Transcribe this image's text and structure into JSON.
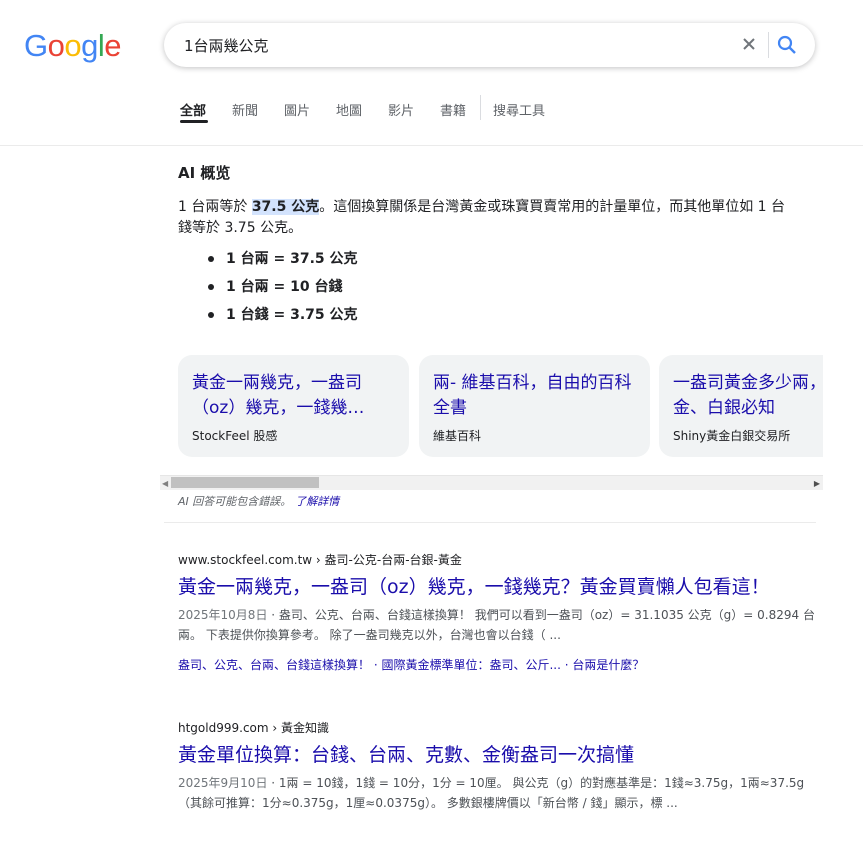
{
  "logo": {
    "letters": [
      "G",
      "o",
      "o",
      "g",
      "l",
      "e"
    ],
    "colors": [
      "#4285F4",
      "#EA4335",
      "#FBBC05",
      "#4285F4",
      "#34A853",
      "#EA4335"
    ]
  },
  "search": {
    "value": "1台兩幾公克"
  },
  "tabs": [
    "全部",
    "新聞",
    "圖片",
    "地圖",
    "影片",
    "書籍",
    "搜尋工具"
  ],
  "ai": {
    "title": "AI 概览",
    "para_pre": "1 台兩等於 ",
    "para_highlight": "37.5 公克",
    "para_post": "。這個換算關係是台灣黃金或珠寶買賣常用的計量單位，而其他單位如 1 台錢等於 3.75 公克。",
    "bullets": [
      "1 台兩 = 37.5 公克",
      "1 台兩 = 10 台錢",
      "1 台錢 = 3.75 公克"
    ],
    "cards": [
      {
        "title": "黃金一兩幾克，一盎司（oz）幾克，一錢幾…",
        "source": "StockFeel 股感"
      },
      {
        "title": "兩- 維基百科，自由的百科全書",
        "source": "維基百科"
      },
      {
        "title": "一盎司黃金多少兩，買黃金、白銀必知",
        "source": "Shiny黃金白銀交易所"
      }
    ],
    "disclaimer": "AI 回答可能包含錯誤。",
    "learn_more": "了解詳情"
  },
  "results": [
    {
      "url": "www.stockfeel.com.tw › 盎司-公克-台兩-台銀-黃金",
      "title": "黃金一兩幾克，一盎司（oz）幾克，一錢幾克？黃金買賣懶人包看這！",
      "date": "2025年10月8日",
      "snippet": " · 盎司、公克、台兩、台錢這樣換算！ 我們可以看到一盎司（oz）= 31.1035 公克（g）= 0.8294 台兩。 下表提供你換算參考。 除了一盎司幾克以外，台灣也會以台錢（ ...",
      "links": "盎司、公克、台兩、台錢這樣換算！ · 國際黃金標準單位：盎司、公斤... · 台兩是什麼？"
    },
    {
      "url": "htgold999.com › 黃金知識",
      "title": "黃金單位換算：台錢、台兩、克數、金衡盎司一次搞懂",
      "date": "2025年9月10日",
      "snippet": " · 1兩 = 10錢，1錢 = 10分，1分 = 10厘。 與公克（g）的對應基準是：1錢≈3.75g，1兩≈37.5g（其餘可推算：1分≈0.375g，1厘≈0.0375g）。 多數銀樓牌價以「新台幣 / 錢」顯示，標 ...",
      "links": ""
    }
  ]
}
